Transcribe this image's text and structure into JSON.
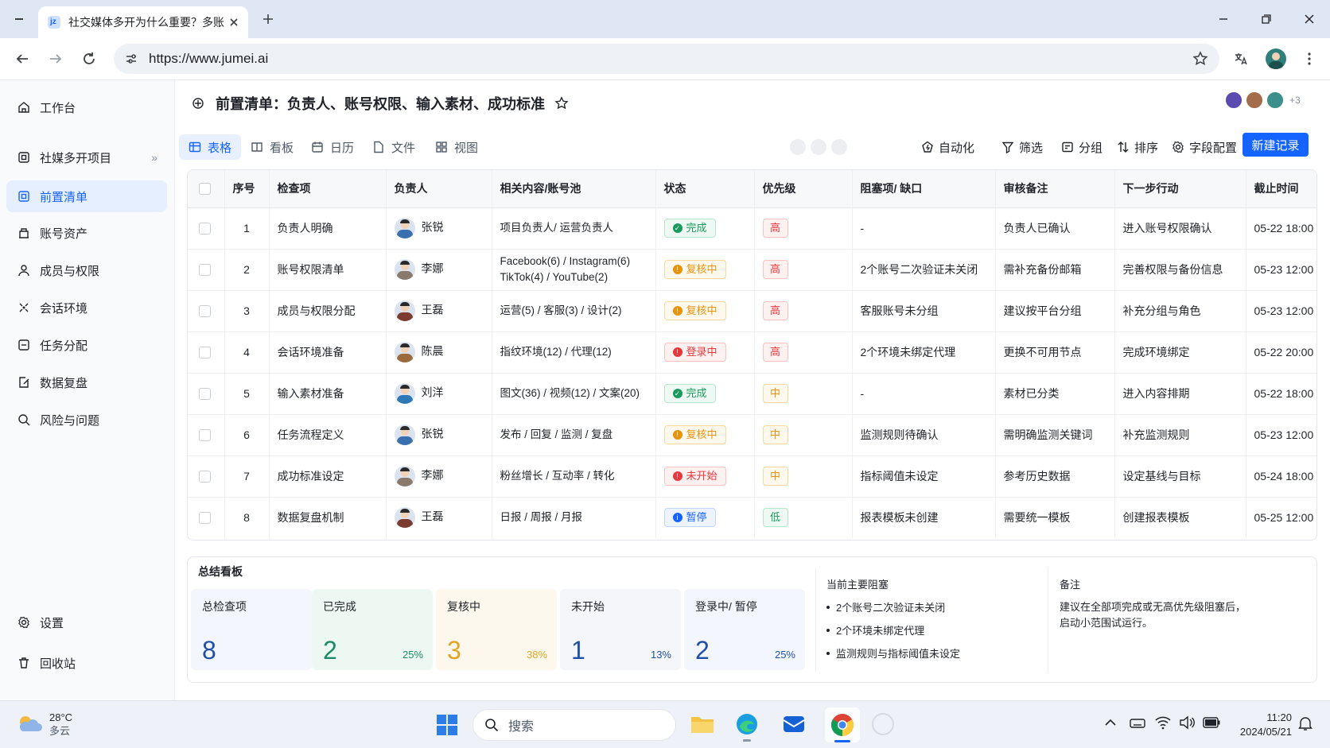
{
  "browser": {
    "tab_title": "社交媒体多开为什么重要？多账",
    "url": "https://www.jumei.ai"
  },
  "sidebar": {
    "items": [
      {
        "label": "工作台",
        "icon": "home-icon"
      },
      {
        "label": "社媒多开项目",
        "icon": "project-icon"
      },
      {
        "label": "前置清单",
        "icon": "checklist-icon"
      },
      {
        "label": "账号资产",
        "icon": "assets-icon"
      },
      {
        "label": "成员与权限",
        "icon": "user-icon"
      },
      {
        "label": "会话环境",
        "icon": "session-icon"
      },
      {
        "label": "任务分配",
        "icon": "task-icon"
      },
      {
        "label": "数据复盘",
        "icon": "data-icon"
      },
      {
        "label": "风险与问题",
        "icon": "search-icon"
      }
    ],
    "bottom": [
      {
        "label": "设置"
      },
      {
        "label": "回收站"
      }
    ],
    "expand": "»"
  },
  "page": {
    "title": "前置清单：负责人、账号权限、输入素材、成功标准",
    "collab_more": "+3"
  },
  "views": [
    {
      "label": "表格"
    },
    {
      "label": "看板"
    },
    {
      "label": "日历"
    },
    {
      "label": "文件"
    },
    {
      "label": "视图"
    }
  ],
  "toolbar": {
    "automation": "自动化",
    "filter": "筛选",
    "group": "分组",
    "sort": "排序",
    "fields": "字段配置",
    "new_record": "新建记录"
  },
  "table": {
    "headers": [
      "序号",
      "检查项",
      "负责人",
      "相关内容/账号池",
      "状态",
      "优先级",
      "阻塞项/ 缺口",
      "审核备注",
      "下一步行动",
      "截止时间"
    ],
    "rows": [
      {
        "no": "1",
        "item": "负责人明确",
        "owner": "张锐",
        "content": "项目负责人/ 运营负责人",
        "status": "完成",
        "priority": "高",
        "block": "-",
        "note": "负责人已确认",
        "next": "进入账号权限确认",
        "due": "05-22 18:00"
      },
      {
        "no": "2",
        "item": "账号权限清单",
        "owner": "李娜",
        "content": "Facebook(6) / Instagram(6) TikTok(4) / YouTube(2)",
        "status": "复核中",
        "priority": "高",
        "block": "2个账号二次验证未关闭",
        "note": "需补充备份邮箱",
        "next": "完善权限与备份信息",
        "due": "05-23 12:00"
      },
      {
        "no": "3",
        "item": "成员与权限分配",
        "owner": "王磊",
        "content": "运营(5) / 客服(3) / 设计(2)",
        "status": "复核中",
        "priority": "高",
        "block": "客服账号未分组",
        "note": "建议按平台分组",
        "next": "补充分组与角色",
        "due": "05-23 12:00"
      },
      {
        "no": "4",
        "item": "会话环境准备",
        "owner": "陈晨",
        "content": "指纹环境(12) / 代理(12)",
        "status": "登录中",
        "priority": "高",
        "block": "2个环境未绑定代理",
        "note": "更换不可用节点",
        "next": "完成环境绑定",
        "due": "05-22 20:00"
      },
      {
        "no": "5",
        "item": "输入素材准备",
        "owner": "刘洋",
        "content": "图文(36) / 视频(12) / 文案(20)",
        "status": "完成",
        "priority": "中",
        "block": "-",
        "note": "素材已分类",
        "next": "进入内容排期",
        "due": "05-22 18:00"
      },
      {
        "no": "6",
        "item": "任务流程定义",
        "owner": "张锐",
        "content": "发布 / 回复 / 监测 / 复盘",
        "status": "复核中",
        "priority": "中",
        "block": "监测规则待确认",
        "note": "需明确监测关键词",
        "next": "补充监测规则",
        "due": "05-23 12:00"
      },
      {
        "no": "7",
        "item": "成功标准设定",
        "owner": "李娜",
        "content": "粉丝增长 / 互动率 / 转化",
        "status": "未开始",
        "priority": "中",
        "block": "指标阈值未设定",
        "note": "参考历史数据",
        "next": "设定基线与目标",
        "due": "05-24 18:00"
      },
      {
        "no": "8",
        "item": "数据复盘机制",
        "owner": "王磊",
        "content": "日报 / 周报 / 月报",
        "status": "暂停",
        "priority": "低",
        "block": "报表模板未创建",
        "note": "需要统一模板",
        "next": "创建报表模板",
        "due": "05-25 12:00"
      }
    ]
  },
  "summary": {
    "title": "总结看板",
    "cards": [
      {
        "label": "总检查项",
        "value": "8",
        "pct": ""
      },
      {
        "label": "已完成",
        "value": "2",
        "pct": "25%"
      },
      {
        "label": "复核中",
        "value": "3",
        "pct": "38%"
      },
      {
        "label": "未开始",
        "value": "1",
        "pct": "13%"
      },
      {
        "label": "登录中/ 暂停",
        "value": "2",
        "pct": "25%"
      }
    ],
    "blockers_title": "当前主要阻塞",
    "blockers": [
      "2个账号二次验证未关闭",
      "2个环境未绑定代理",
      "监测规则与指标阈值未设定"
    ],
    "notes_title": "备注",
    "notes_text": "建议在全部项完成或无高优先级阻塞后，启动小范围试运行。"
  },
  "taskbar": {
    "temp": "28°C",
    "weather": "多云",
    "search": "搜索",
    "time": "11:20",
    "date": "2024/05/21"
  },
  "colors": {
    "accent": "#1664ff"
  }
}
